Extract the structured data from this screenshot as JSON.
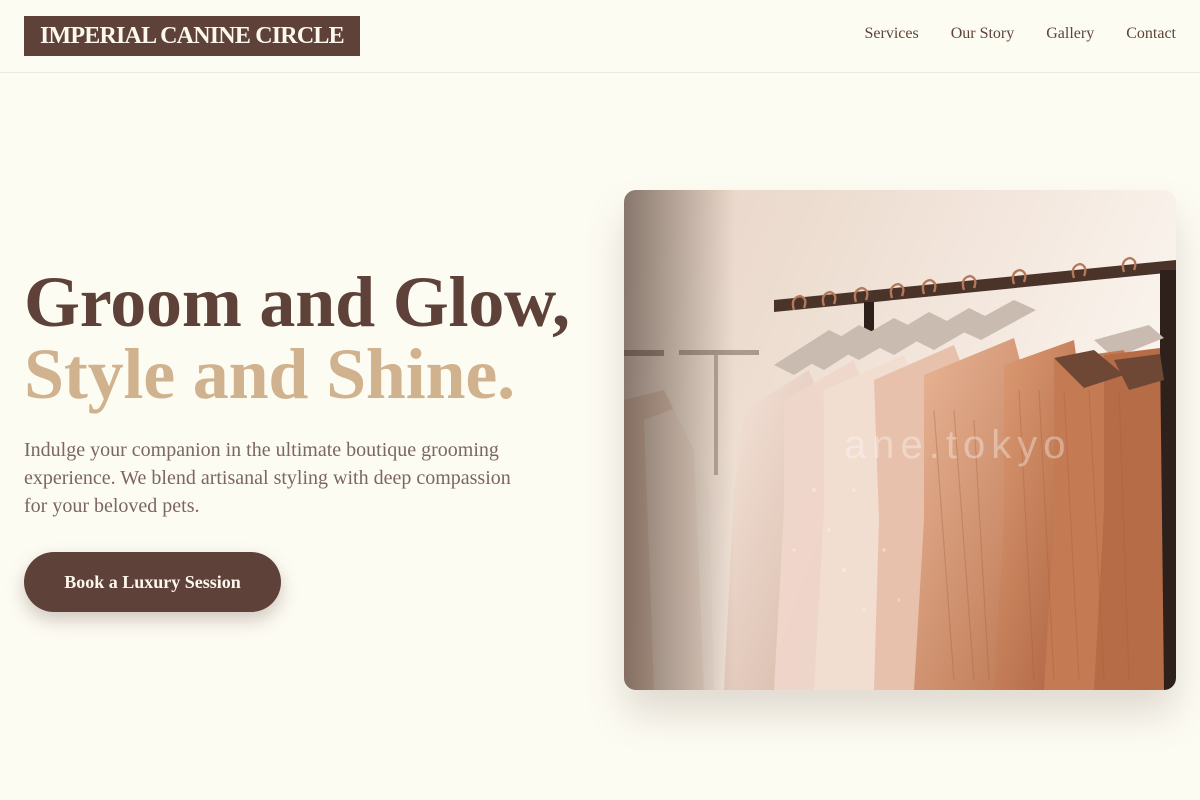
{
  "header": {
    "logo": "IMPERIAL CANINE CIRCLE",
    "nav": [
      "Services",
      "Our Story",
      "Gallery",
      "Contact"
    ]
  },
  "hero": {
    "title_line1": "Groom and Glow,",
    "title_line2": "Style and Shine.",
    "description": "Indulge your companion in the ultimate boutique grooming experience. We blend artisanal styling with deep compassion for your beloved pets.",
    "cta_label": "Book a Luxury Session",
    "image_alt": "Garments on hangers on a clothing rack",
    "image_watermark": "ane.tokyo"
  },
  "colors": {
    "background": "#fdfcf3",
    "brand": "#5e4239",
    "accent": "#d1b28f",
    "muted_text": "#7b6660"
  }
}
